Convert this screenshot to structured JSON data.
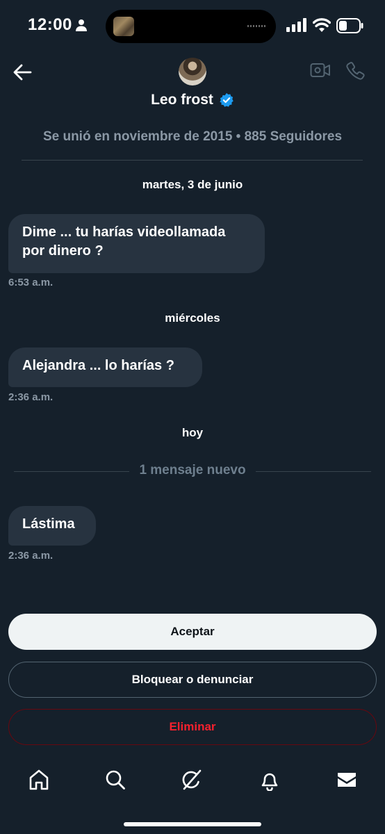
{
  "status_bar": {
    "time": "12:00"
  },
  "header": {
    "name": "Leo frost",
    "joined_info": "Se unió en noviembre de 2015 • 885 Seguidores"
  },
  "conversation": {
    "separators": [
      "martes, 3 de junio",
      "miércoles",
      "hoy"
    ],
    "new_messages_label": "1 mensaje nuevo",
    "messages": [
      {
        "lines": [
          "Dime ... tu harías videollamada",
          "por dinero ?"
        ],
        "time": "6:53 a.m."
      },
      {
        "lines": [
          "Alejandra ... lo harías ?"
        ],
        "time": "2:36 a.m."
      },
      {
        "lines": [
          "Lástima"
        ],
        "time": "2:36 a.m."
      }
    ]
  },
  "actions": {
    "accept": "Aceptar",
    "block_report": "Bloquear o denunciar",
    "delete": "Eliminar"
  },
  "bottom_nav": [
    "home-icon",
    "search-icon",
    "grok-icon",
    "notifications-icon",
    "messages-icon"
  ],
  "colors": {
    "background": "#15202b",
    "bubble": "#273340",
    "accent": "#1d9bf0",
    "danger": "#f4212e"
  }
}
